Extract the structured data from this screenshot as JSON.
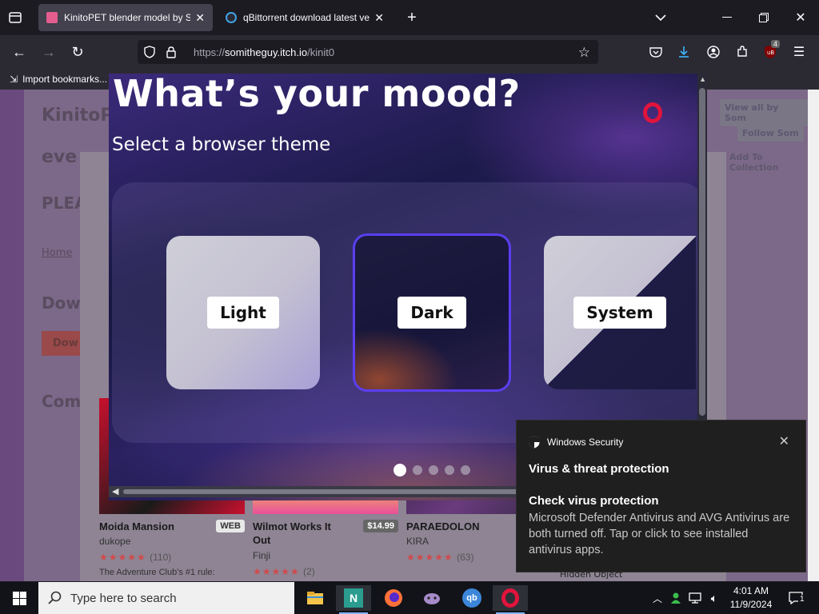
{
  "browser": {
    "tabs": [
      {
        "title": "KinitoPET blender model by So",
        "active": true
      },
      {
        "title": "qBittorrent download latest ver",
        "active": false
      }
    ],
    "url": {
      "protocol": "https://",
      "host": "somitheguy.itch.io",
      "path": "/kinit0"
    },
    "bookmarks_import_label": "Import bookmarks...",
    "extension_badge": "4"
  },
  "page": {
    "title_fragment": "KinitoP",
    "subtitle_fragment": "eve",
    "warn_fragment": "PLEA",
    "link_fragment": "Home",
    "download_heading": "Dow",
    "download_button": "Dow",
    "comments_heading": "Com",
    "side_actions": [
      "View all by Som",
      "Follow Som",
      "Add To Collection"
    ],
    "hidden_object_text": "Hidden Object",
    "games": [
      {
        "name": "Moida Mansion",
        "author": "dukope",
        "badge": "WEB",
        "rating_count": "(110)",
        "desc": "The Adventure Club's #1 rule:"
      },
      {
        "name": "Wilmot Works It Out",
        "author": "Finji",
        "badge": "$14.99",
        "rating_count": "(2)",
        "desc": ""
      },
      {
        "name": "PARAEDOLON",
        "author": "KIRA",
        "badge": "",
        "rating_count": "(63)",
        "desc": ""
      }
    ]
  },
  "theme_popup": {
    "title": "What’s your mood?",
    "subtitle": "Select a browser theme",
    "options": [
      "Light",
      "Dark",
      "System"
    ],
    "selected": "Dark",
    "page_count": 5,
    "current_page": 1
  },
  "toast": {
    "app": "Windows Security",
    "heading": "Virus & threat protection",
    "title": "Check virus protection",
    "body": "Microsoft Defender Antivirus and AVG Antivirus are both turned off. Tap or click to see installed antivirus apps."
  },
  "taskbar": {
    "search_placeholder": "Type here to search",
    "time": "4:01 AM",
    "date": "11/9/2024",
    "notification_count": "1"
  },
  "colors": {
    "opera_red": "#e0143c",
    "selected_border": "#5b3ef0",
    "chrome_bg": "#1c1b22"
  }
}
